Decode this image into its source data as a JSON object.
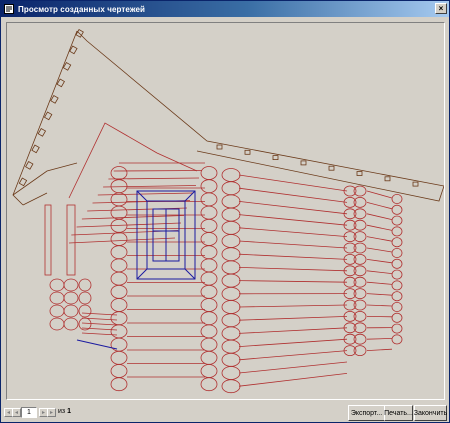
{
  "window": {
    "title": "Просмотр созданных чертежей",
    "close_glyph": "×"
  },
  "drawing": {
    "subject": "log-house-3d-wireframe",
    "colors": {
      "walls": "#b03030",
      "window": "#1a1aa0",
      "roof": "#6b3a1a",
      "background": "#d4d0c8"
    }
  },
  "pagination": {
    "first_glyph": "◂",
    "prev_glyph": "◂",
    "current_page": "1",
    "next_glyph": "▸",
    "last_glyph": "▸",
    "of_label": "из",
    "total_pages": "1"
  },
  "buttons": {
    "export_label": "Экспорт...",
    "print_label": "Печать...",
    "finish_label": "Закончить"
  }
}
